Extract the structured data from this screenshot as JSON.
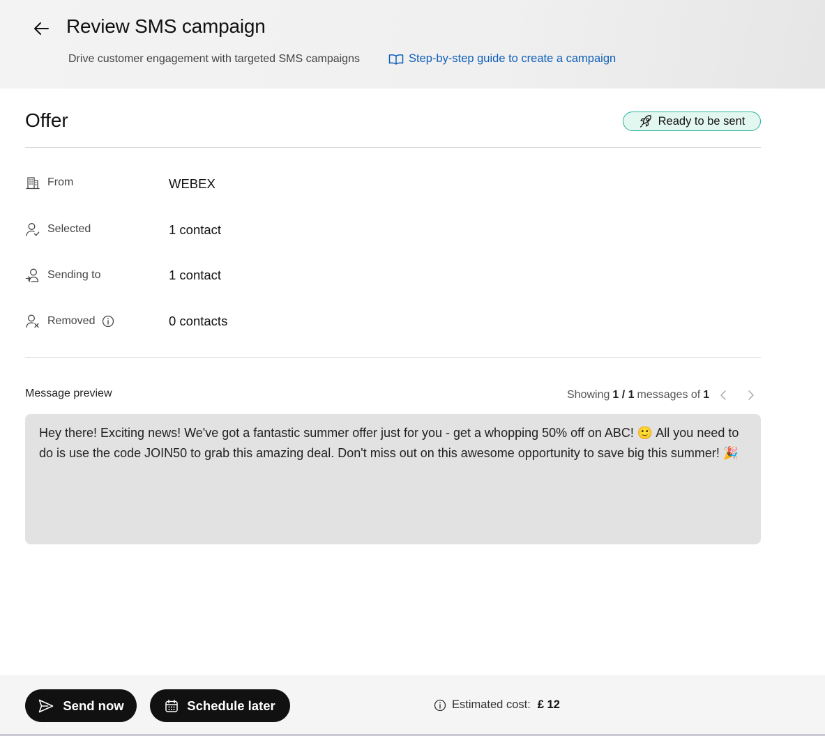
{
  "header": {
    "title": "Review SMS campaign",
    "subtitle": "Drive customer engagement with targeted SMS campaigns",
    "guide_link": "Step-by-step guide to create a campaign"
  },
  "campaign": {
    "name": "Offer",
    "status": "Ready to be sent"
  },
  "details": {
    "from_label": "From",
    "from_value": "WEBEX",
    "selected_label": "Selected",
    "selected_value": "1 contact",
    "sending_label": "Sending to",
    "sending_value": "1 contact",
    "removed_label": "Removed",
    "removed_value": "0 contacts"
  },
  "preview": {
    "label": "Message preview",
    "pager_prefix": "Showing",
    "pager_current": "1 / 1",
    "pager_mid": "messages of",
    "pager_total": "1",
    "message": "Hey there!  Exciting news! We've got a fantastic summer offer just for you - get a whopping 50% off on ABC! 🙂  All you need to do is use the code JOIN50 to grab this amazing deal. Don't miss out on this awesome opportunity to save big this summer! 🎉"
  },
  "footer": {
    "send_now": "Send now",
    "schedule_later": "Schedule later",
    "cost_label": "Estimated cost:",
    "cost_value": "£ 12"
  },
  "colors": {
    "accent_link": "#0f5fb8",
    "status_border": "#28b39a",
    "status_bg": "#e3f7f1",
    "button_dark": "#111111"
  },
  "icons": [
    "arrow-left-icon",
    "book-icon",
    "rocket-icon",
    "building-icon",
    "user-check-icon",
    "user-send-icon",
    "user-remove-icon",
    "info-icon",
    "chevron-left-icon",
    "chevron-right-icon",
    "send-icon",
    "calendar-icon"
  ]
}
